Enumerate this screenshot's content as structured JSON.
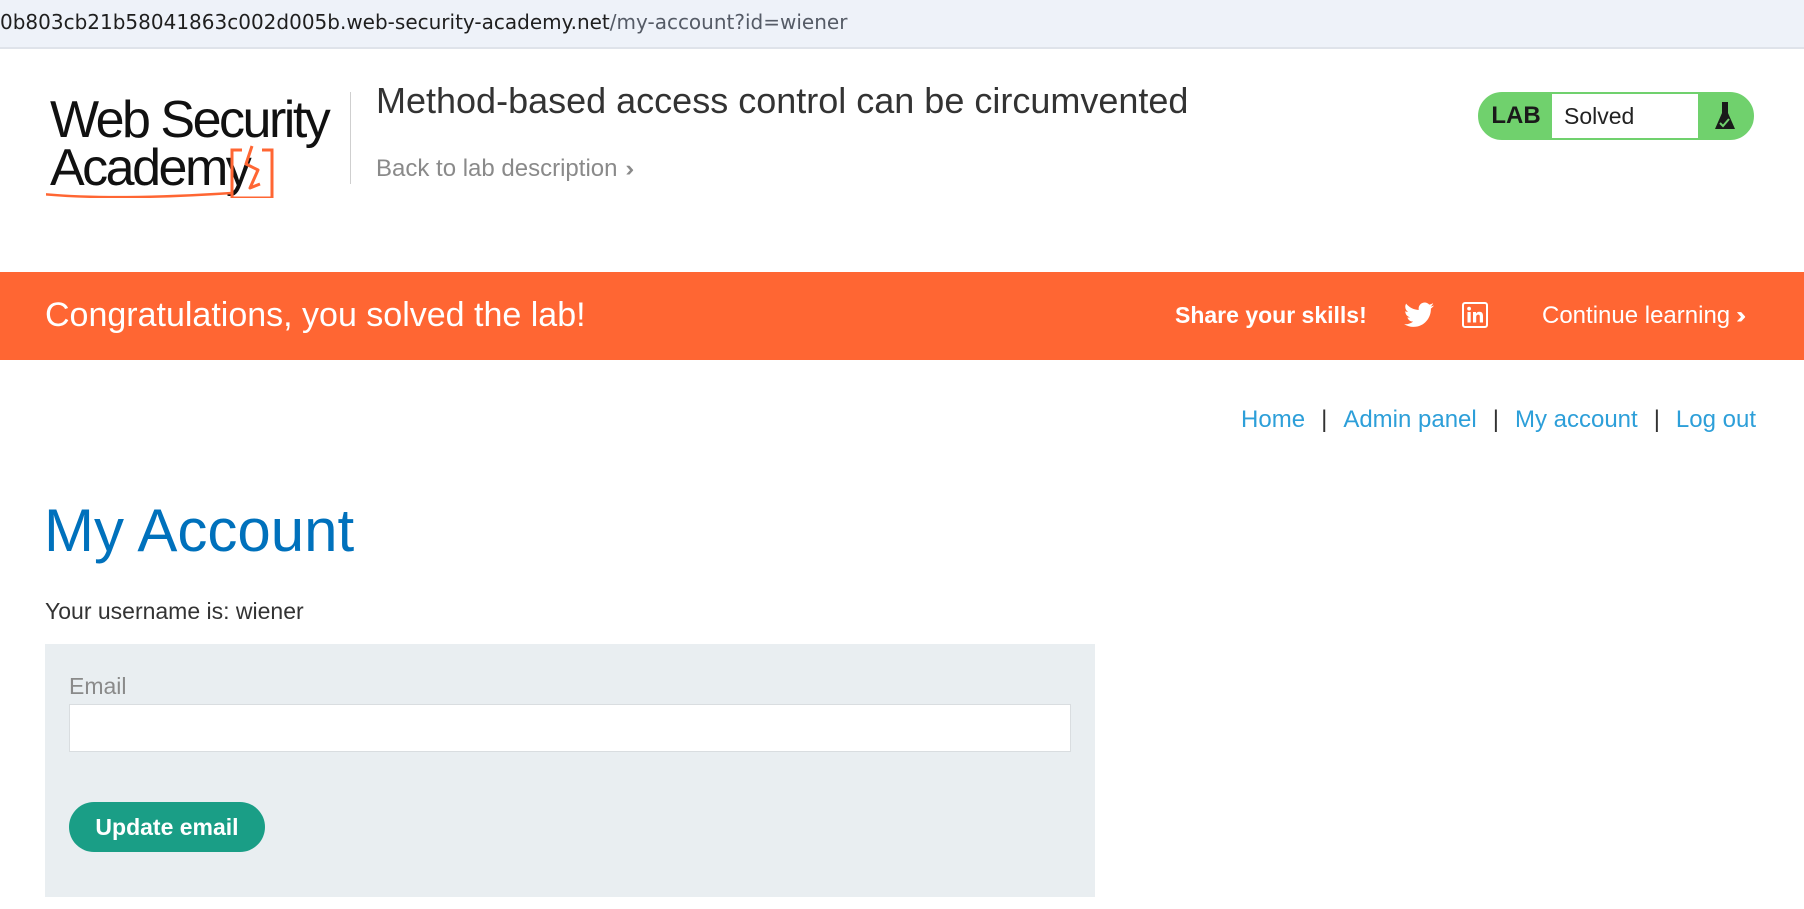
{
  "browser": {
    "url_host": "0b803cb21b58041863c002d005b.web-security-academy.net",
    "url_path": "/my-account?id=wiener"
  },
  "header": {
    "logo_line1": "Web Security",
    "logo_line2": "Academy",
    "lab_title": "Method-based access control can be circumvented",
    "back_link": "Back to lab description",
    "badge_label": "LAB",
    "badge_status": "Solved",
    "colors": {
      "badge_green": "#70d16d",
      "logo_orange": "#ff6633"
    }
  },
  "banner": {
    "message": "Congratulations, you solved the lab!",
    "share_text": "Share your skills!",
    "twitter_icon": "twitter-icon",
    "linkedin_icon": "linkedin-icon",
    "continue_link": "Continue learning",
    "color": "#ff6633"
  },
  "nav": {
    "items": [
      {
        "label": "Home"
      },
      {
        "label": "Admin panel"
      },
      {
        "label": "My account"
      },
      {
        "label": "Log out"
      }
    ],
    "separator": "|",
    "link_color": "#2d9fd9"
  },
  "main": {
    "title": "My Account",
    "username_text": "Your username is: wiener",
    "email_label": "Email",
    "email_value": "",
    "update_button": "Update email",
    "title_color": "#0071bc",
    "button_color": "#1a9e86"
  }
}
